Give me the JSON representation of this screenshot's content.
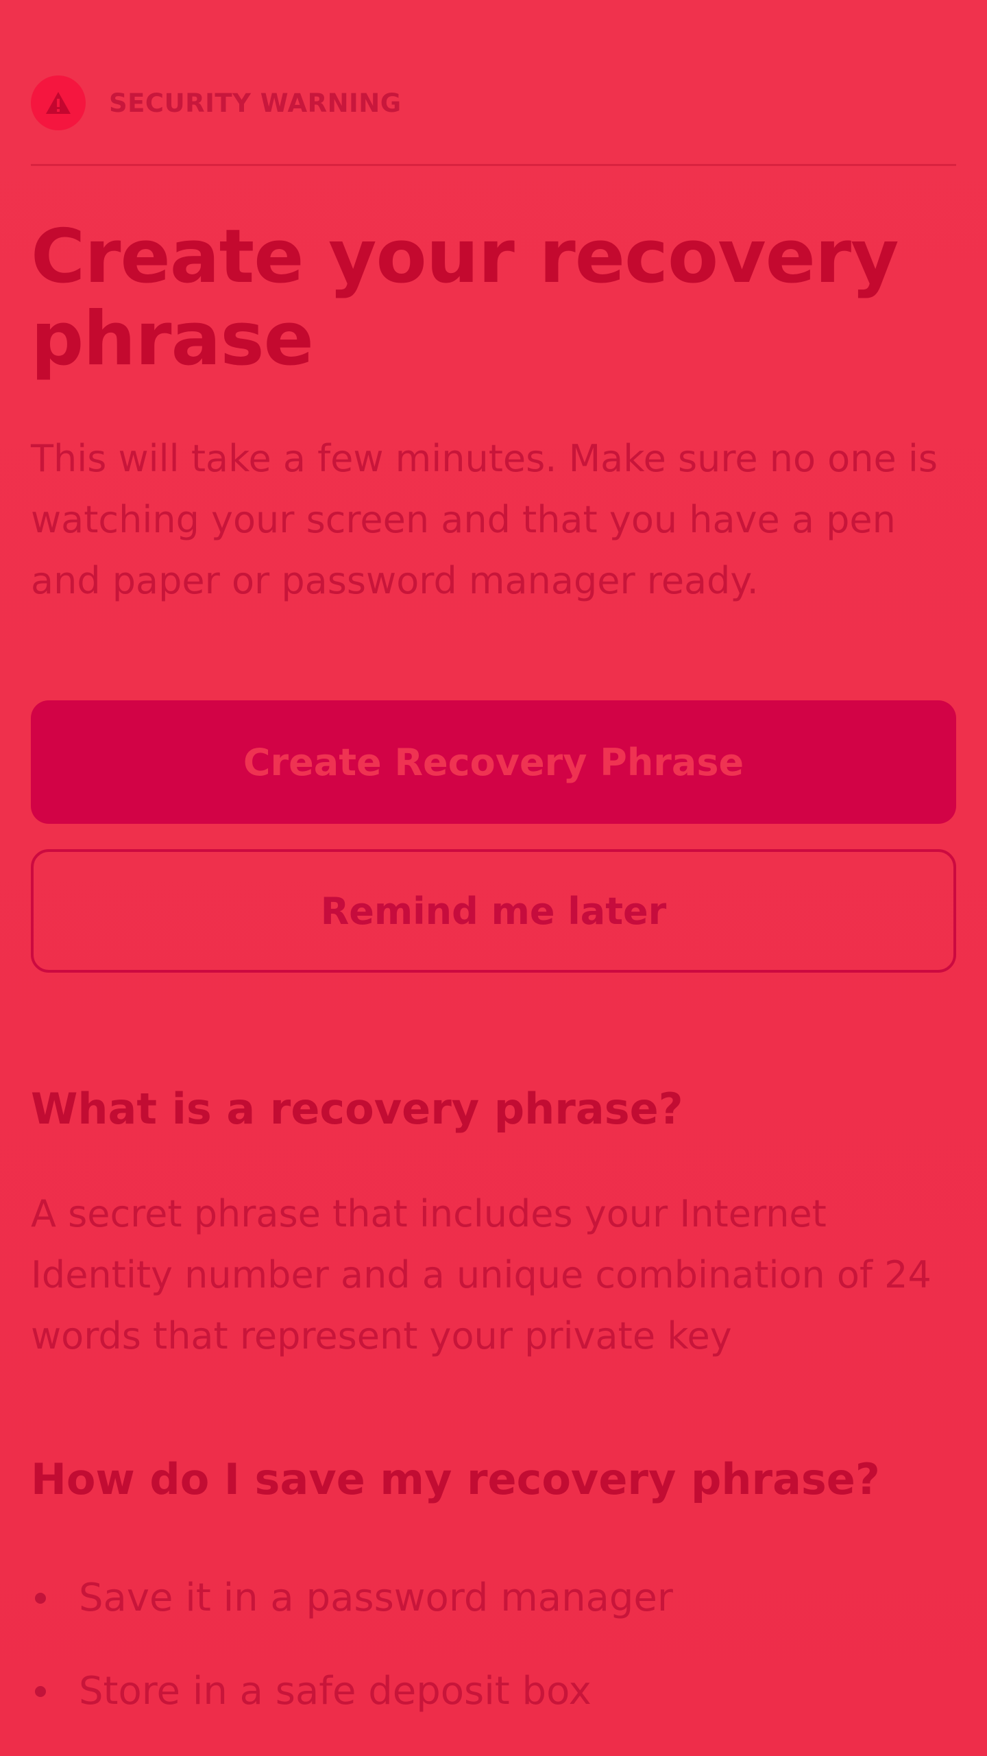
{
  "warning": {
    "icon": "warning-icon",
    "label": "SECURITY WARNING"
  },
  "title": "Create your recovery phrase",
  "lede": "This will take a few minutes. Make sure no one is watching your screen and that you have a pen and paper or password manager ready.",
  "buttons": {
    "create": "Create Recovery Phrase",
    "remind": "Remind me later"
  },
  "faq": {
    "what_heading": "What is a recovery phrase?",
    "what_answer": "A secret phrase that includes your Internet Identity number and a unique combination of 24 words that represent your private key",
    "how_heading": "How do I save my recovery phrase?",
    "tips": [
      "Save it in a password manager",
      "Store in a safe deposit box"
    ]
  },
  "colors": {
    "background": "#ef2d4b",
    "primary_button": "#d20346",
    "text": "#c8153a"
  }
}
